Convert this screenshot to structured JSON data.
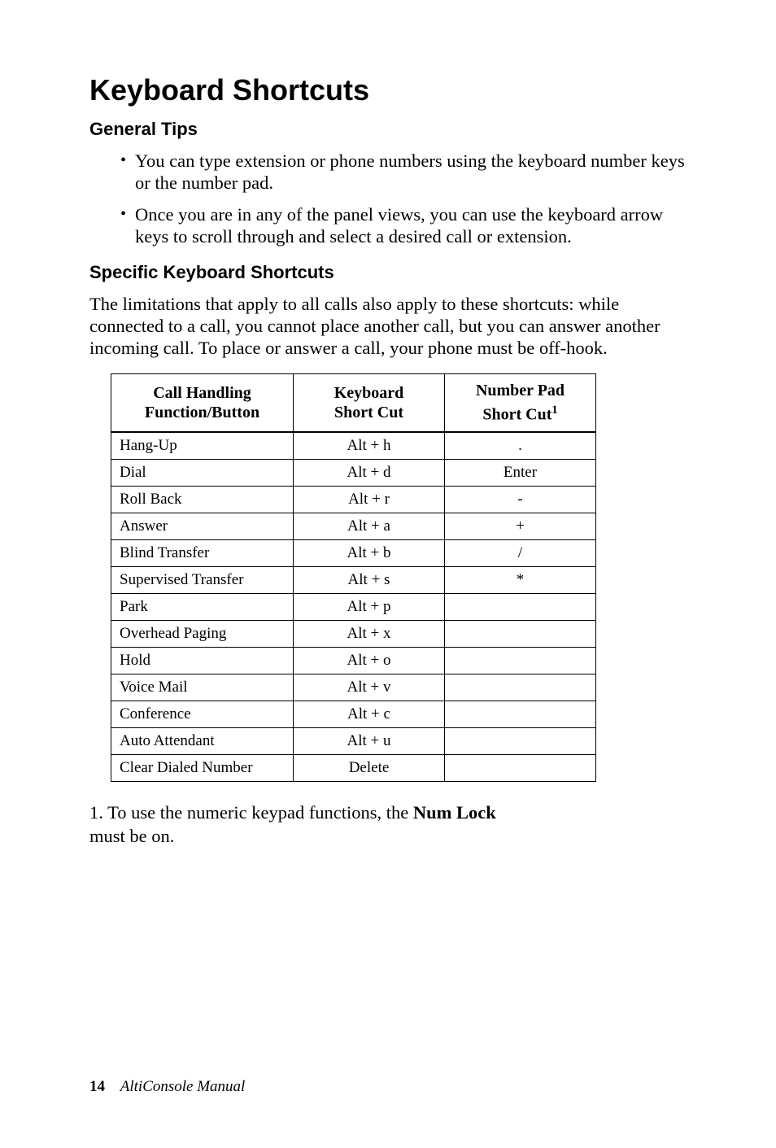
{
  "title": "Keyboard Shortcuts",
  "sections": {
    "general": {
      "heading": "General Tips",
      "bullets": [
        "You can type extension or phone numbers using the keyboard number keys or the number pad.",
        "Once you are in any of the panel views, you can use the keyboard arrow keys to scroll through and select a desired call or extension."
      ]
    },
    "specific": {
      "heading": "Specific Keyboard Shortcuts",
      "intro": "The limitations that apply to all calls also apply to these shortcuts: while connected to a call, you cannot place another call, but you can answer another incoming call. To place or answer a call, your phone must be off-hook."
    }
  },
  "chart_data": {
    "type": "table",
    "title": "Keyboard Shortcuts",
    "columns": [
      {
        "header_line1": "Call Handling",
        "header_line2": "Function/Button"
      },
      {
        "header_line1": "Keyboard",
        "header_line2": "Short Cut"
      },
      {
        "header_line1": "Number Pad",
        "header_line2": "Short Cut",
        "footnote_ref": "1"
      }
    ],
    "rows": [
      {
        "func": "Hang-Up",
        "key": "Alt + h",
        "num": "."
      },
      {
        "func": "Dial",
        "key": "Alt + d",
        "num": "Enter"
      },
      {
        "func": "Roll Back",
        "key": "Alt + r",
        "num": "-"
      },
      {
        "func": "Answer",
        "key": "Alt + a",
        "num": "+"
      },
      {
        "func": "Blind Transfer",
        "key": "Alt + b",
        "num": "/"
      },
      {
        "func": "Supervised Transfer",
        "key": "Alt + s",
        "num": "*"
      },
      {
        "func": "Park",
        "key": "Alt + p",
        "num": ""
      },
      {
        "func": "Overhead Paging",
        "key": "Alt + x",
        "num": ""
      },
      {
        "func": "Hold",
        "key": "Alt + o",
        "num": ""
      },
      {
        "func": "Voice Mail",
        "key": "Alt + v",
        "num": ""
      },
      {
        "func": "Conference",
        "key": "Alt + c",
        "num": ""
      },
      {
        "func": "Auto Attendant",
        "key": "Alt + u",
        "num": ""
      },
      {
        "func": "Clear Dialed Number",
        "key": "Delete",
        "num": ""
      }
    ]
  },
  "footnote": {
    "prefix": "1. To use the numeric keypad functions, the ",
    "bold": "Num Lock",
    "suffix": "must be on."
  },
  "footer": {
    "page": "14",
    "doc_title": "AltiConsole Manual"
  }
}
